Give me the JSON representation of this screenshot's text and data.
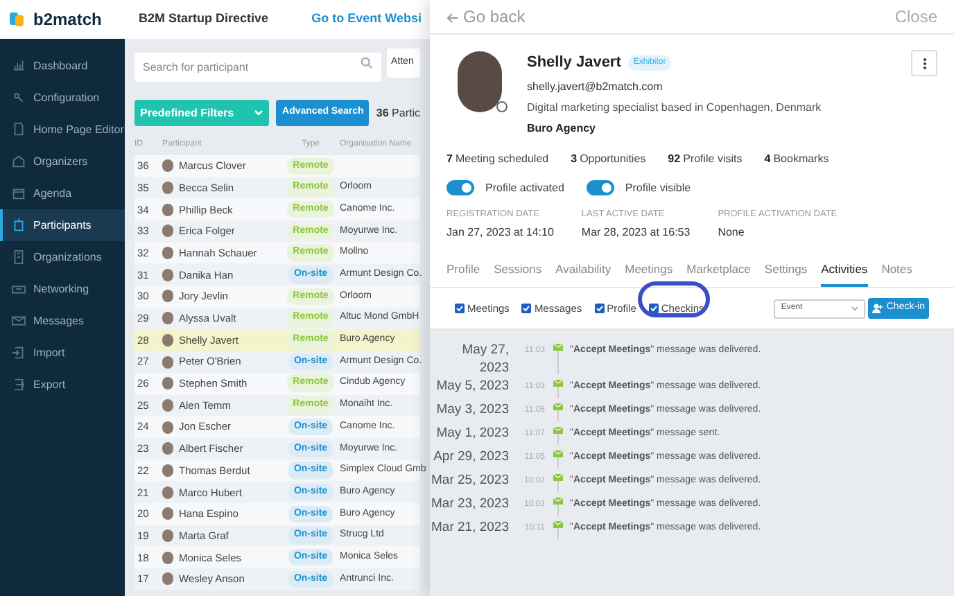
{
  "header": {
    "logo_text": "b2match",
    "event_title": "B2M Startup Directive",
    "website_link": "Go to Event Websi"
  },
  "sidebar": {
    "items": [
      {
        "label": "Dashboard",
        "selected": false
      },
      {
        "label": "Configuration",
        "selected": false
      },
      {
        "label": "Home Page Editor",
        "selected": false
      },
      {
        "label": "Organizers",
        "selected": false
      },
      {
        "label": "Agenda",
        "selected": false
      },
      {
        "label": "Participants",
        "selected": true
      },
      {
        "label": "Organizations",
        "selected": false
      },
      {
        "label": "Networking",
        "selected": false
      },
      {
        "label": "Messages",
        "selected": false
      },
      {
        "label": "Import",
        "selected": false
      },
      {
        "label": "Export",
        "selected": false
      }
    ]
  },
  "toolbar": {
    "search_placeholder": "Search for participant",
    "attendee_filter": "Atten",
    "predefined_filters": "Predefined Filters",
    "advanced_search": "Advanced Search",
    "count": "36",
    "count_label": "Partic"
  },
  "table": {
    "columns": [
      "ID",
      "Participant",
      "Type",
      "Organisation Name"
    ],
    "rows": [
      {
        "id": "36",
        "name": "Marcus Clover",
        "type": "Remote",
        "kind": "remote",
        "organisation": "",
        "selected": false
      },
      {
        "id": "35",
        "name": "Becca Selin",
        "type": "Remote",
        "kind": "remote",
        "organisation": "Orloom",
        "selected": false
      },
      {
        "id": "34",
        "name": "Phillip Beck",
        "type": "Remote",
        "kind": "remote",
        "organisation": "Canome Inc.",
        "selected": false
      },
      {
        "id": "33",
        "name": "Erica Folger",
        "type": "Remote",
        "kind": "remote",
        "organisation": "Moyurwe Inc.",
        "selected": false
      },
      {
        "id": "32",
        "name": "Hannah Schauer",
        "type": "Remote",
        "kind": "remote",
        "organisation": "Mollno",
        "selected": false
      },
      {
        "id": "31",
        "name": "Danika Han",
        "type": "On-site",
        "kind": "onsite",
        "organisation": "Armunt Design Co.",
        "selected": false
      },
      {
        "id": "30",
        "name": "Jory Jevlin",
        "type": "Remote",
        "kind": "remote",
        "organisation": "Orloom",
        "selected": false
      },
      {
        "id": "29",
        "name": "Alyssa Uvalt",
        "type": "Remote",
        "kind": "remote",
        "organisation": "Altuc Mond GmbH",
        "selected": false
      },
      {
        "id": "28",
        "name": "Shelly Javert",
        "type": "Remote",
        "kind": "remote",
        "organisation": "Buro Agency",
        "selected": true
      },
      {
        "id": "27",
        "name": "Peter O'Brien",
        "type": "On-site",
        "kind": "onsite",
        "organisation": "Armunt Design Co.",
        "selected": false
      },
      {
        "id": "26",
        "name": "Stephen Smith",
        "type": "Remote",
        "kind": "remote",
        "organisation": "Cindub Agency",
        "selected": false
      },
      {
        "id": "25",
        "name": "Alen Temm",
        "type": "Remote",
        "kind": "remote",
        "organisation": "Monaiht Inc.",
        "selected": false
      },
      {
        "id": "24",
        "name": "Jon Escher",
        "type": "On-site",
        "kind": "onsite",
        "organisation": "Canome Inc.",
        "selected": false
      },
      {
        "id": "23",
        "name": "Albert Fischer",
        "type": "On-site",
        "kind": "onsite",
        "organisation": "Moyurwe Inc.",
        "selected": false
      },
      {
        "id": "22",
        "name": "Thomas Berdut",
        "type": "On-site",
        "kind": "onsite",
        "organisation": "Simplex Cloud Gmb",
        "selected": false
      },
      {
        "id": "21",
        "name": "Marco Hubert",
        "type": "On-site",
        "kind": "onsite",
        "organisation": "Buro Agency",
        "selected": false
      },
      {
        "id": "20",
        "name": "Hana Espino",
        "type": "On-site",
        "kind": "onsite",
        "organisation": "Buro Agency",
        "selected": false
      },
      {
        "id": "19",
        "name": "Marta Graf",
        "type": "On-site",
        "kind": "onsite",
        "organisation": "Strucg Ltd",
        "selected": false
      },
      {
        "id": "18",
        "name": "Monica Seles",
        "type": "On-site",
        "kind": "onsite",
        "organisation": "Monica Seles",
        "selected": false
      },
      {
        "id": "17",
        "name": "Wesley Anson",
        "type": "On-site",
        "kind": "onsite",
        "organisation": "Antrunci Inc.",
        "selected": false
      }
    ]
  },
  "panel": {
    "back": "Go back",
    "close": "Close",
    "profile": {
      "name": "Shelly Javert",
      "badge": "Exhibitor",
      "email": "shelly.javert@b2match.com",
      "bio": "Digital marketing specialist based in Copenhagen, Denmark",
      "organisation": "Buro Agency"
    },
    "stats": [
      {
        "value": "7",
        "label": "Meeting scheduled"
      },
      {
        "value": "3",
        "label": "Opportunities"
      },
      {
        "value": "92",
        "label": "Profile visits"
      },
      {
        "value": "4",
        "label": "Bookmarks"
      }
    ],
    "toggles": [
      {
        "label": "Profile activated",
        "on": true
      },
      {
        "label": "Profile visible",
        "on": true
      }
    ],
    "dates": [
      {
        "label": "REGISTRATION DATE",
        "value": "Jan 27, 2023 at 14:10"
      },
      {
        "label": "LAST ACTIVE DATE",
        "value": "Mar 28, 2023 at 16:53"
      },
      {
        "label": "PROFILE ACTIVATION DATE",
        "value": "None"
      }
    ],
    "tabs": [
      {
        "label": "Profile",
        "selected": false
      },
      {
        "label": "Sessions",
        "selected": false
      },
      {
        "label": "Availability",
        "selected": false
      },
      {
        "label": "Meetings",
        "selected": false
      },
      {
        "label": "Marketplace",
        "selected": false
      },
      {
        "label": "Settings",
        "selected": false
      },
      {
        "label": "Activities",
        "selected": true
      },
      {
        "label": "Notes",
        "selected": false
      }
    ],
    "filters": [
      {
        "label": "Meetings",
        "checked": true
      },
      {
        "label": "Messages",
        "checked": true
      },
      {
        "label": "Profile",
        "checked": true
      },
      {
        "label": "Checkins",
        "checked": true
      }
    ],
    "event_select": "Event",
    "checkin_button": "Check-in",
    "activities": [
      {
        "date": "May 27, 2023",
        "time": "11:03",
        "text": "\"**Accept Meetings**\" message was delivered."
      },
      {
        "date": "May 5, 2023",
        "time": "11:03",
        "text": "\"**Accept Meetings**\" message was delivered."
      },
      {
        "date": "May 3, 2023",
        "time": "11:06",
        "text": "\"**Accept Meetings**\" message was delivered."
      },
      {
        "date": "May 1, 2023",
        "time": "11:07",
        "text": "\"**Accept Meetings**\" message sent."
      },
      {
        "date": "Apr 29, 2023",
        "time": "11:05",
        "text": "\"**Accept Meetings**\" message was delivered."
      },
      {
        "date": "Mar 25, 2023",
        "time": "10:02",
        "text": "\"**Accept Meetings**\" message was delivered."
      },
      {
        "date": "Mar 23, 2023",
        "time": "10:03",
        "text": "\"**Accept Meetings**\" message was delivered."
      },
      {
        "date": "Mar 21, 2023",
        "time": "10:11",
        "text": "\"**Accept Meetings**\" message was delivered."
      }
    ]
  }
}
